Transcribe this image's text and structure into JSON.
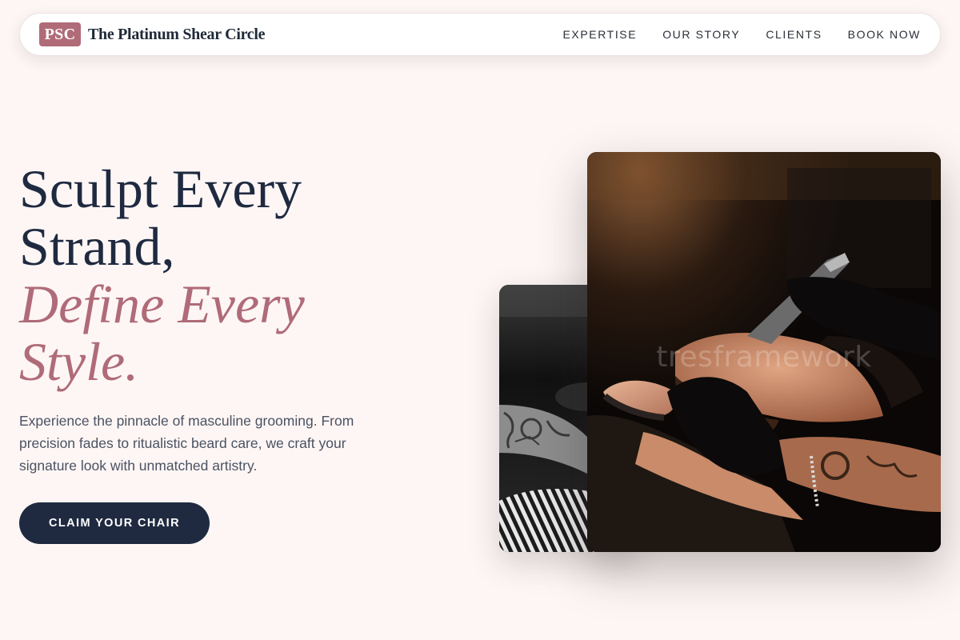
{
  "brand": {
    "badge": "PSC",
    "name": "The Platinum Shear Circle"
  },
  "nav": {
    "links": [
      {
        "label": "EXPERTISE"
      },
      {
        "label": "OUR STORY"
      },
      {
        "label": "CLIENTS"
      },
      {
        "label": "BOOK NOW"
      }
    ]
  },
  "hero": {
    "title_line1": "Sculpt Every",
    "title_line2": "Strand,",
    "title_accent1": "Define Every",
    "title_accent2": "Style.",
    "description": "Experience the pinnacle of masculine grooming. From precision fades to ritualistic beard care, we craft your signature look with unmatched artistry.",
    "cta_label": "CLAIM YOUR CHAIR"
  },
  "images": {
    "back_photo": "black-and-white-tattooed-barber-photo",
    "front_photo": "barber-straight-razor-shave-photo",
    "watermark": "tresframework"
  },
  "colors": {
    "background": "#fdf6f5",
    "accent": "#b06b78",
    "navy": "#1f2a40",
    "body_text": "#4b5262"
  }
}
